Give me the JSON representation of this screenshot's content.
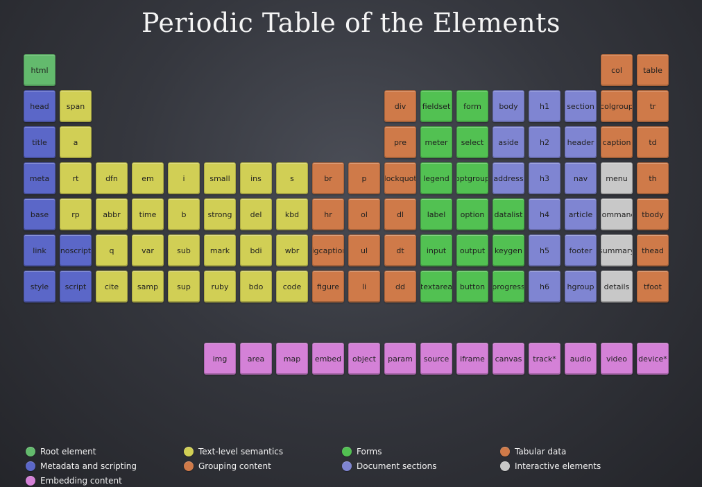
{
  "page": {
    "title": "Periodic Table of the Elements"
  },
  "colors": {
    "root": "#63ba6d",
    "meta": "#5b67c8",
    "text": "#d1cf55",
    "group": "#cf7a49",
    "forms": "#52c152",
    "sections": "#7f85d2",
    "tabular": "#cf7a49",
    "interactive": "#c8c8c8",
    "embed": "#d481d7"
  },
  "tiles": [
    {
      "name": "html",
      "cat": "root"
    },
    {
      "name": "head",
      "cat": "meta"
    },
    {
      "name": "title",
      "cat": "meta"
    },
    {
      "name": "meta",
      "cat": "meta"
    },
    {
      "name": "base",
      "cat": "meta"
    },
    {
      "name": "link",
      "cat": "meta"
    },
    {
      "name": "style",
      "cat": "meta"
    },
    {
      "name": "span",
      "cat": "text"
    },
    {
      "name": "a",
      "cat": "text"
    },
    {
      "name": "rt",
      "cat": "text"
    },
    {
      "name": "rp",
      "cat": "text"
    },
    {
      "name": "noscript",
      "cat": "meta"
    },
    {
      "name": "script",
      "cat": "meta"
    },
    {
      "name": "dfn",
      "cat": "text"
    },
    {
      "name": "abbr",
      "cat": "text"
    },
    {
      "name": "q",
      "cat": "text"
    },
    {
      "name": "cite",
      "cat": "text"
    },
    {
      "name": "em",
      "cat": "text"
    },
    {
      "name": "time",
      "cat": "text"
    },
    {
      "name": "var",
      "cat": "text"
    },
    {
      "name": "samp",
      "cat": "text"
    },
    {
      "name": "i",
      "cat": "text"
    },
    {
      "name": "b",
      "cat": "text"
    },
    {
      "name": "sub",
      "cat": "text"
    },
    {
      "name": "sup",
      "cat": "text"
    },
    {
      "name": "small",
      "cat": "text"
    },
    {
      "name": "strong",
      "cat": "text"
    },
    {
      "name": "mark",
      "cat": "text"
    },
    {
      "name": "ruby",
      "cat": "text"
    },
    {
      "name": "ins",
      "cat": "text"
    },
    {
      "name": "del",
      "cat": "text"
    },
    {
      "name": "bdi",
      "cat": "text"
    },
    {
      "name": "bdo",
      "cat": "text"
    },
    {
      "name": "s",
      "cat": "text"
    },
    {
      "name": "kbd",
      "cat": "text"
    },
    {
      "name": "wbr",
      "cat": "text"
    },
    {
      "name": "code",
      "cat": "text"
    },
    {
      "name": "br",
      "cat": "group"
    },
    {
      "name": "hr",
      "cat": "group"
    },
    {
      "name": "figcaption",
      "cat": "group"
    },
    {
      "name": "figure",
      "cat": "group"
    },
    {
      "name": "p",
      "cat": "group"
    },
    {
      "name": "ol",
      "cat": "group"
    },
    {
      "name": "ul",
      "cat": "group"
    },
    {
      "name": "li",
      "cat": "group"
    },
    {
      "name": "div",
      "cat": "group"
    },
    {
      "name": "pre",
      "cat": "group"
    },
    {
      "name": "blockquote",
      "cat": "group"
    },
    {
      "name": "dl",
      "cat": "group"
    },
    {
      "name": "dt",
      "cat": "group"
    },
    {
      "name": "dd",
      "cat": "group"
    },
    {
      "name": "fieldset",
      "cat": "forms"
    },
    {
      "name": "meter",
      "cat": "forms"
    },
    {
      "name": "legend",
      "cat": "forms"
    },
    {
      "name": "label",
      "cat": "forms"
    },
    {
      "name": "input",
      "cat": "forms"
    },
    {
      "name": "textarea",
      "cat": "forms"
    },
    {
      "name": "form",
      "cat": "forms"
    },
    {
      "name": "select",
      "cat": "forms"
    },
    {
      "name": "optgroup",
      "cat": "forms"
    },
    {
      "name": "option",
      "cat": "forms"
    },
    {
      "name": "output",
      "cat": "forms"
    },
    {
      "name": "button",
      "cat": "forms"
    },
    {
      "name": "body",
      "cat": "sections"
    },
    {
      "name": "aside",
      "cat": "sections"
    },
    {
      "name": "address",
      "cat": "sections"
    },
    {
      "name": "datalist",
      "cat": "forms"
    },
    {
      "name": "keygen",
      "cat": "forms"
    },
    {
      "name": "progress",
      "cat": "forms"
    },
    {
      "name": "h1",
      "cat": "sections"
    },
    {
      "name": "h2",
      "cat": "sections"
    },
    {
      "name": "h3",
      "cat": "sections"
    },
    {
      "name": "h4",
      "cat": "sections"
    },
    {
      "name": "h5",
      "cat": "sections"
    },
    {
      "name": "h6",
      "cat": "sections"
    },
    {
      "name": "section",
      "cat": "sections"
    },
    {
      "name": "header",
      "cat": "sections"
    },
    {
      "name": "nav",
      "cat": "sections"
    },
    {
      "name": "article",
      "cat": "sections"
    },
    {
      "name": "footer",
      "cat": "sections"
    },
    {
      "name": "hgroup",
      "cat": "sections"
    },
    {
      "name": "col",
      "cat": "tabular"
    },
    {
      "name": "colgroup",
      "cat": "tabular"
    },
    {
      "name": "caption",
      "cat": "tabular"
    },
    {
      "name": "menu",
      "cat": "interactive"
    },
    {
      "name": "command",
      "cat": "interactive"
    },
    {
      "name": "summary",
      "cat": "interactive"
    },
    {
      "name": "details",
      "cat": "interactive"
    },
    {
      "name": "table",
      "cat": "tabular"
    },
    {
      "name": "tr",
      "cat": "tabular"
    },
    {
      "name": "td",
      "cat": "tabular"
    },
    {
      "name": "th",
      "cat": "tabular"
    },
    {
      "name": "tbody",
      "cat": "tabular"
    },
    {
      "name": "thead",
      "cat": "tabular"
    },
    {
      "name": "tfoot",
      "cat": "tabular"
    },
    {
      "name": "img",
      "cat": "embed"
    },
    {
      "name": "area",
      "cat": "embed"
    },
    {
      "name": "map",
      "cat": "embed"
    },
    {
      "name": "embed",
      "cat": "embed"
    },
    {
      "name": "object",
      "cat": "embed"
    },
    {
      "name": "param",
      "cat": "embed"
    },
    {
      "name": "source",
      "cat": "embed"
    },
    {
      "name": "iframe",
      "cat": "embed"
    },
    {
      "name": "canvas",
      "cat": "embed"
    },
    {
      "name": "track*",
      "cat": "embed"
    },
    {
      "name": "audio",
      "cat": "embed"
    },
    {
      "name": "video",
      "cat": "embed"
    },
    {
      "name": "device*",
      "cat": "embed"
    }
  ],
  "legend": [
    {
      "label": "Root element",
      "cat": "root"
    },
    {
      "label": "Text-level semantics",
      "cat": "text"
    },
    {
      "label": "Forms",
      "cat": "forms"
    },
    {
      "label": "Tabular data",
      "cat": "tabular"
    },
    {
      "label": "Metadata and scripting",
      "cat": "meta"
    },
    {
      "label": "Grouping content",
      "cat": "group"
    },
    {
      "label": "Document sections",
      "cat": "sections"
    },
    {
      "label": "Interactive elements",
      "cat": "interactive"
    },
    {
      "label": "Embedding content",
      "cat": "embed"
    }
  ]
}
